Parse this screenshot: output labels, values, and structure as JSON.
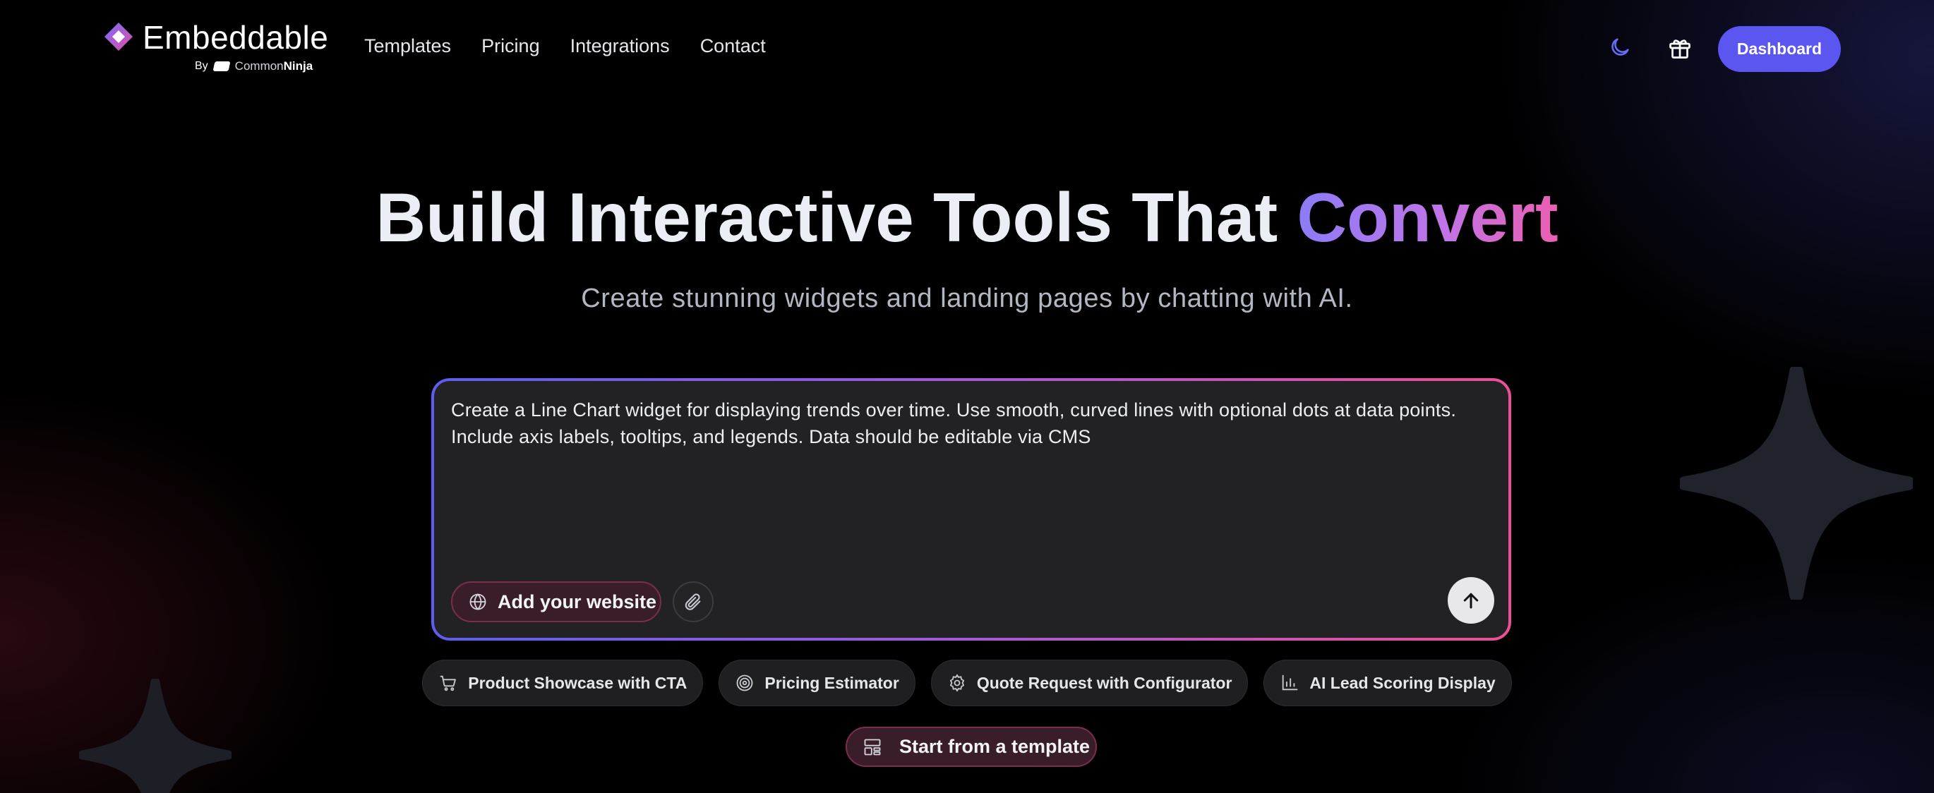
{
  "brand": {
    "name": "Embeddable",
    "by": "By",
    "partner_prefix": "Common",
    "partner_suffix": "Ninja"
  },
  "nav": {
    "items": [
      {
        "label": "Templates"
      },
      {
        "label": "Pricing"
      },
      {
        "label": "Integrations"
      },
      {
        "label": "Contact"
      }
    ]
  },
  "header": {
    "dashboard_label": "Dashboard"
  },
  "hero": {
    "title_main": "Build Interactive Tools That ",
    "title_accent": "Convert",
    "subtitle": "Create stunning widgets and landing pages by chatting with AI."
  },
  "prompt": {
    "value": "Create a Line Chart widget for displaying trends over time. Use smooth, curved lines with optional dots at data points. Include axis labels, tooltips, and legends. Data should be editable via CMS",
    "add_website_label": "Add your website"
  },
  "suggestions": [
    {
      "label": "Product Showcase with CTA",
      "icon": "cart-icon"
    },
    {
      "label": "Pricing Estimator",
      "icon": "target-icon"
    },
    {
      "label": "Quote Request with Configurator",
      "icon": "gear-icon"
    },
    {
      "label": "AI Lead Scoring Display",
      "icon": "bar-chart-icon"
    }
  ],
  "template_button": {
    "label": "Start from a template"
  },
  "colors": {
    "accent": "#5b56f0",
    "gradient_start": "#5b5ef0",
    "gradient_end": "#ec4f94"
  }
}
